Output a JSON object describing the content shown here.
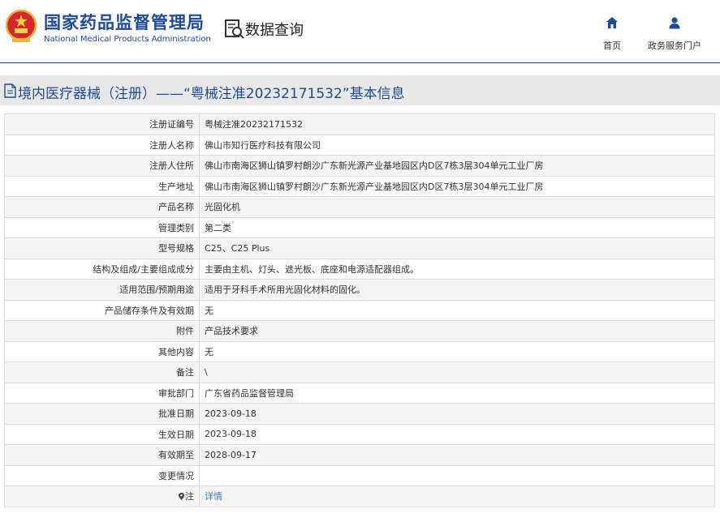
{
  "header": {
    "agency_name_cn": "国家药品监督管理局",
    "agency_name_en": "National Medical Products Administration",
    "query_label": "数据查询",
    "nav": [
      {
        "label": "首页",
        "icon": "home-icon"
      },
      {
        "label": "政务服务门户",
        "icon": "user-icon"
      }
    ],
    "brand_color": "#1d4b98"
  },
  "page_title": "境内医疗器械（注册）——“粤械注准20232171532”基本信息",
  "rows": [
    {
      "label": "注册证编号",
      "value": "粤械注准20232171532"
    },
    {
      "label": "注册人名称",
      "value": "佛山市知行医疗科技有限公司"
    },
    {
      "label": "注册人住所",
      "value": "佛山市南海区狮山镇罗村朗沙广东新光源产业基地园区内D区7栋3层304单元工业厂房"
    },
    {
      "label": "生产地址",
      "value": "佛山市南海区狮山镇罗村朗沙广东新光源产业基地园区内D区7栋3层304单元工业厂房"
    },
    {
      "label": "产品名称",
      "value": "光固化机"
    },
    {
      "label": "管理类别",
      "value": "第二类"
    },
    {
      "label": "型号规格",
      "value": "C25、C25 Plus"
    },
    {
      "label": "结构及组成/主要组成成分",
      "value": "主要由主机、灯头、遮光板、底座和电源适配器组成。"
    },
    {
      "label": "适用范围/预期用途",
      "value": "适用于牙科手术所用光固化材料的固化。"
    },
    {
      "label": "产品储存条件及有效期",
      "value": "无"
    },
    {
      "label": "附件",
      "value": "产品技术要求"
    },
    {
      "label": "其他内容",
      "value": "无"
    },
    {
      "label": "备注",
      "value": "\\"
    },
    {
      "label": "审批部门",
      "value": "广东省药品监督管理局"
    },
    {
      "label": "批准日期",
      "value": "2023-09-18"
    },
    {
      "label": "生效日期",
      "value": "2023-09-18"
    },
    {
      "label": "有效期至",
      "value": "2028-09-17"
    },
    {
      "label": "变更情况",
      "value": ""
    }
  ],
  "note_row": {
    "label": "注",
    "link_text": "详情",
    "icon": "pin-icon"
  }
}
